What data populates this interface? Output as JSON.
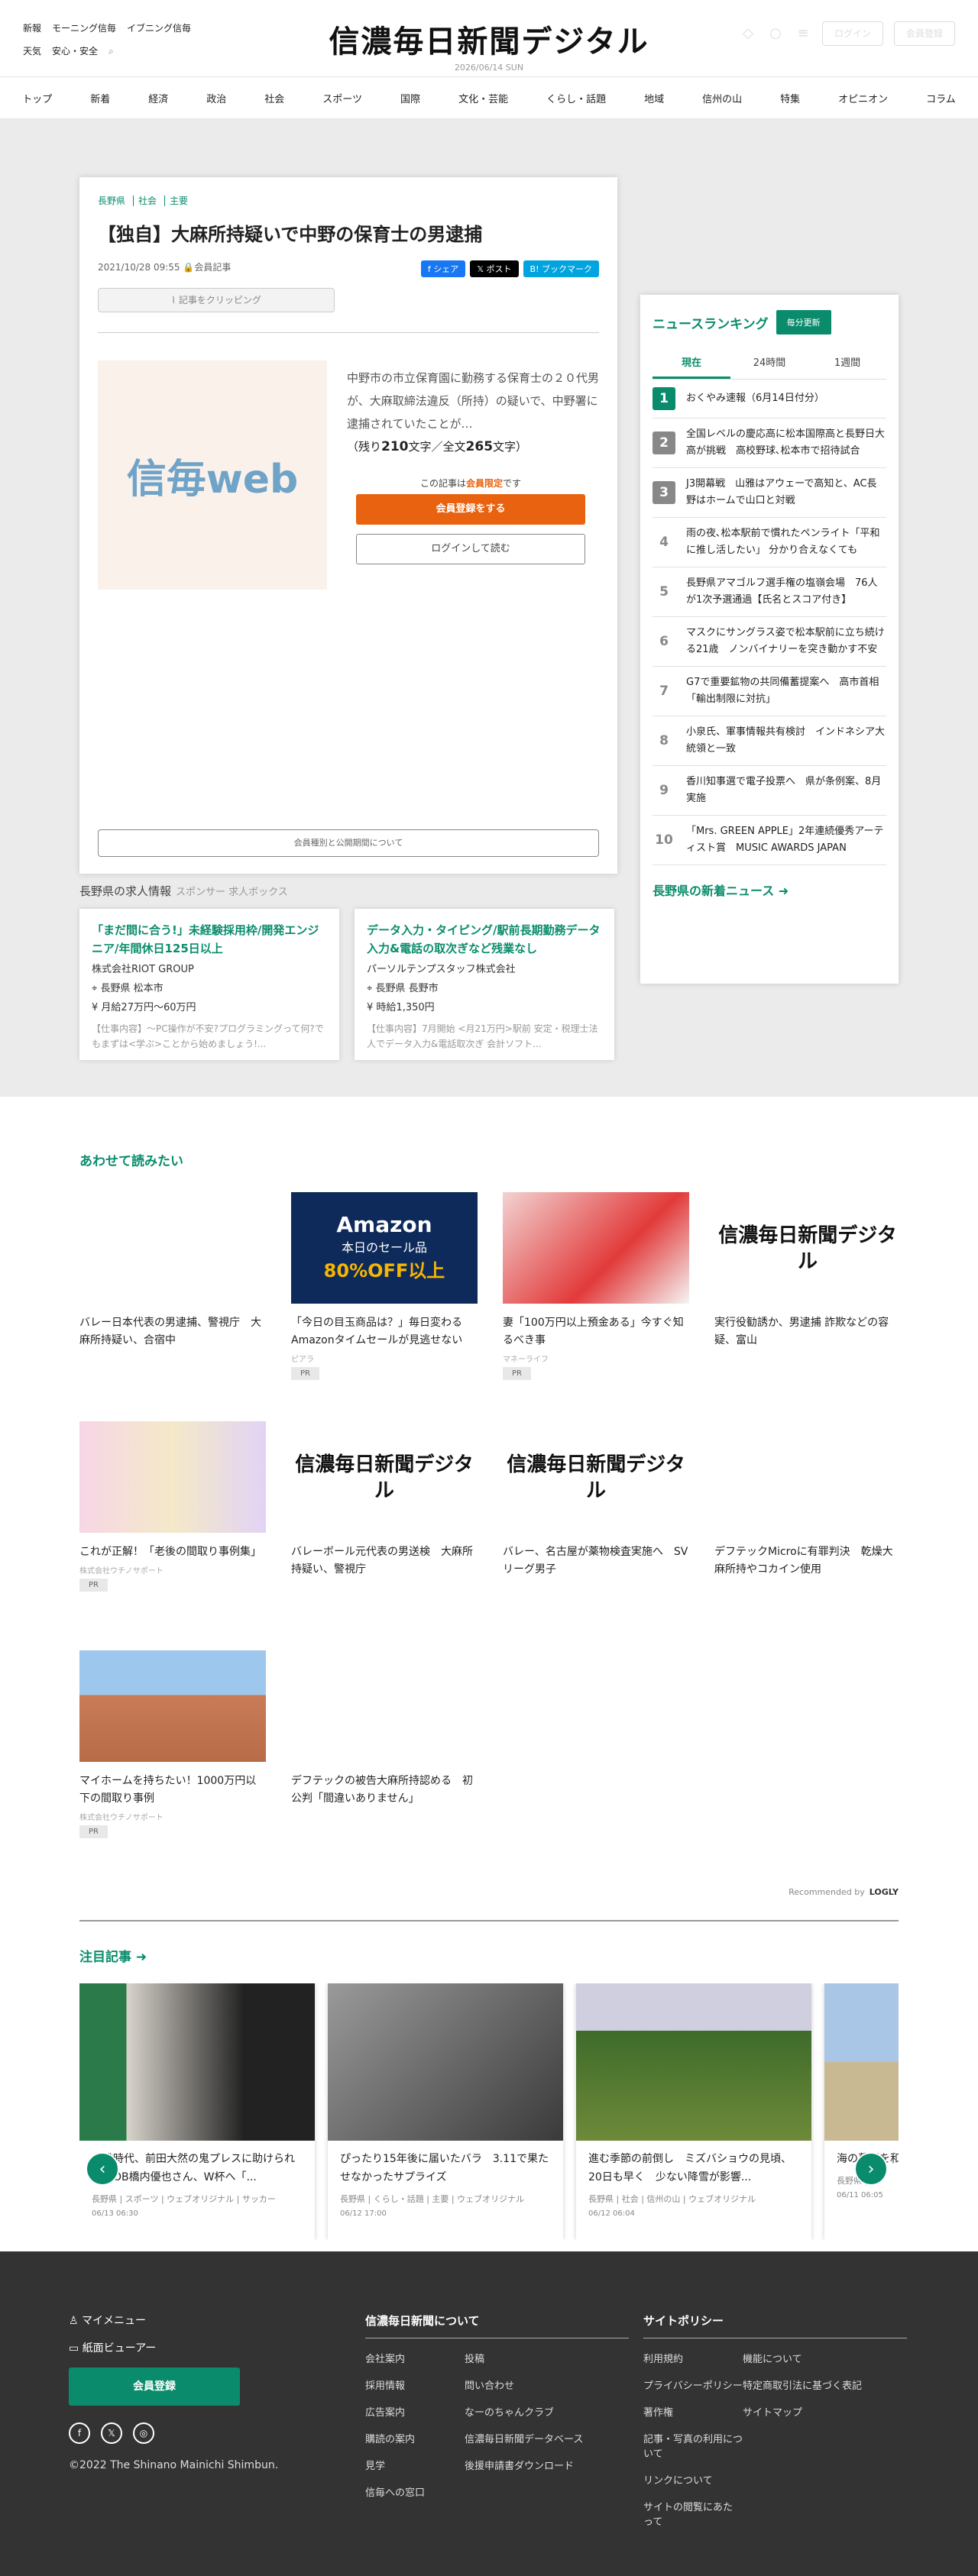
{
  "header": {
    "left_links": [
      "新報",
      "モーニング信毎",
      "イブニング信毎",
      "天気",
      "安心・安全"
    ],
    "logo": "信濃毎日新聞デジタル",
    "date": "2026/06/14 SUN",
    "login": "ログイン",
    "register": "会員登録"
  },
  "nav": [
    "トップ",
    "新着",
    "経済",
    "政治",
    "社会",
    "スポーツ",
    "国際",
    "文化・芸能",
    "くらし・話題",
    "地域",
    "信州の山",
    "特集",
    "オピニオン",
    "コラム"
  ],
  "article": {
    "tags": [
      "長野県",
      "社会",
      "主要"
    ],
    "title": "【独自】大麻所持疑いで中野の保育士の男逮捕",
    "date": "2021/10/28 09:55",
    "member": "会員記事",
    "share": [
      "シェア",
      "ポスト",
      "ブックマーク"
    ],
    "clip": "記事をクリッピング",
    "thumb": "信毎web",
    "lead": "中野市の市立保育園に勤務する保育士の２０代男が、大麻取締法違反（所持）の疑いで、中野署に逮捕されていたことが…",
    "remain": "（残り",
    "remain_n": "210",
    "remain_mid": "文字／全文",
    "total_n": "265",
    "remain_end": "文字）",
    "member_note1": "この記事は",
    "member_note2": "会員限定",
    "member_note3": "です",
    "reg_btn": "会員登録をする",
    "login_btn": "ログインして読む",
    "footer_btn": "会員種別と公開期間について"
  },
  "jobs": {
    "title": "長野県の求人情報",
    "sponsor": "スポンサー 求人ボックス",
    "items": [
      {
        "title": "「まだ間に合う!」未経験採用枠/開発エンジニア/年間休日125日以上",
        "company": "株式会社RIOT GROUP",
        "loc": "長野県 松本市",
        "pay": "月給27万円～60万円",
        "desc": "【仕事内容】～PC操作が不安?プログラミングって何?でもまずは<学ぶ>ことから始めましょう!..."
      },
      {
        "title": "データ入力・タイピング/駅前長期勤務データ入力&電話の取次ぎなど残業なし",
        "company": "パーソルテンプスタッフ株式会社",
        "loc": "長野県 長野市",
        "pay": "時給1,350円",
        "desc": "【仕事内容】7月開始 <月21万円>駅前 安定・税理士法人でデータ入力&電話取次ぎ 会計ソフト..."
      }
    ]
  },
  "ranking": {
    "title": "ニュースランキング",
    "update": "毎分更新",
    "tabs": [
      "現在",
      "24時間",
      "1週間"
    ],
    "items": [
      {
        "n": "1",
        "t": "おくやみ速報（6月14日付分）"
      },
      {
        "n": "2",
        "t": "全国レベルの慶応高に松本国際高と長野日大高が挑戦　高校野球､松本市で招待試合"
      },
      {
        "n": "3",
        "t": "J3開幕戦　山雅はアウェーで高知と、AC長野はホームで山口と対戦"
      },
      {
        "n": "4",
        "t": "雨の夜､松本駅前で慣れたペンライト「平和に推し活したい」 分かり合えなくても"
      },
      {
        "n": "5",
        "t": "長野県アマゴルフ選手権の塩嶺会場　76人が1次予選通過【氏名とスコア付き】"
      },
      {
        "n": "6",
        "t": "マスクにサングラス姿で松本駅前に立ち続ける21歳　ノンバイナリーを突き動かす不安"
      },
      {
        "n": "7",
        "t": "G7で重要鉱物の共同備蓄提案へ　高市首相「輸出制限に対抗」"
      },
      {
        "n": "8",
        "t": "小泉氏、軍事情報共有検討　インドネシア大統領と一致"
      },
      {
        "n": "9",
        "t": "香川知事選で電子投票へ　県が条例案、8月実施"
      },
      {
        "n": "10",
        "t": "「Mrs. GREEN APPLE」2年連続優秀アーティスト賞　MUSIC AWARDS JAPAN"
      }
    ],
    "more": "長野県の新着ニュース"
  },
  "related": {
    "title": "あわせて読みたい",
    "items": [
      {
        "t": "バレー日本代表の男逮捕、警視庁　大麻所持疑い、合宿中",
        "src": "",
        "pr": ""
      },
      {
        "t": "「今日の目玉商品は？」毎日変わるAmazonタイムセールが見逃せない",
        "src": "ピアラ",
        "pr": "PR",
        "amz": "Amazon",
        "amz2": "本日のセール品",
        "amz3": "80%OFF以上"
      },
      {
        "t": "妻「100万円以上預金ある」今すぐ知るべき事",
        "src": "マネーライフ",
        "pr": "PR"
      },
      {
        "t": "実行役勧誘か、男逮捕 詐欺などの容疑、富山",
        "src": "",
        "pr": ""
      },
      {
        "t": "これが正解！「老後の間取り事例集」",
        "src": "株式会社ウチノサポート",
        "pr": "PR"
      },
      {
        "t": "バレーボール元代表の男送検　大麻所持疑い、警視庁",
        "src": "",
        "pr": ""
      },
      {
        "t": "バレー、名古屋が薬物検査実施へ　SVリーグ男子",
        "src": "",
        "pr": ""
      },
      {
        "t": "デフテックMicroに有罪判決　乾燥大麻所持やコカイン使用",
        "src": "",
        "pr": ""
      },
      {
        "t": "マイホームを持ちたい！1000万円以下の間取り事例",
        "src": "株式会社ウチノサポート",
        "pr": "PR"
      },
      {
        "t": "デフテックの被告大麻所持認める　初公判「間違いありません」",
        "src": "",
        "pr": ""
      }
    ],
    "logo": "信濃毎日新聞デジタル",
    "reco": "Recommended by",
    "reco_brand": "LOGLY"
  },
  "featured": {
    "title": "注目記事",
    "items": [
      {
        "t": "山雅時代、前田大然の鬼プレスに助けられた　OB橋内優也さん、W杯へ「...",
        "m": "長野県 | スポーツ | ウェブオリジナル | サッカー",
        "d": "06/13 06:30"
      },
      {
        "t": "ぴったり15年後に届いたバラ　3.11で果たせなかったサプライズ",
        "m": "長野県 | くらし・話題 | 主要 | ウェブオリジナル",
        "d": "06/12 17:00"
      },
      {
        "t": "進む季節の前倒し　ミズバショウの見頃、20日も早く　少ない降雪が影響...",
        "m": "長野県 | 社会 | 信州の山 | ウェブオリジナル",
        "d": "06/12 06:04"
      },
      {
        "t": "海の幕張を和」な景色",
        "m": "長野県 | く",
        "d": "06/11 06:05"
      }
    ]
  },
  "footer": {
    "my": "マイメニュー",
    "viewer": "紙面ビューアー",
    "reg": "会員登録",
    "copy": "©2022 The Shinano Mainichi Shimbun.",
    "col1": {
      "title": "信濃毎日新聞について",
      "links": [
        "会社案内",
        "投稿",
        "採用情報",
        "問い合わせ",
        "広告案内",
        "なーのちゃんクラブ",
        "購読の案内",
        "信濃毎日新聞データベース",
        "見学",
        "後援申請書ダウンロード",
        "信毎への窓口",
        ""
      ]
    },
    "col2": {
      "title": "サイトポリシー",
      "links": [
        "利用規約",
        "機能について",
        "プライバシーポリシー",
        "特定商取引法に基づく表記",
        "著作権",
        "サイトマップ",
        "記事・写真の利用について",
        "",
        "リンクについて",
        "",
        "サイトの閲覧にあたって",
        ""
      ]
    }
  },
  "colors": {
    "accent": "#0a8c6c",
    "orange": "#e8620f"
  }
}
